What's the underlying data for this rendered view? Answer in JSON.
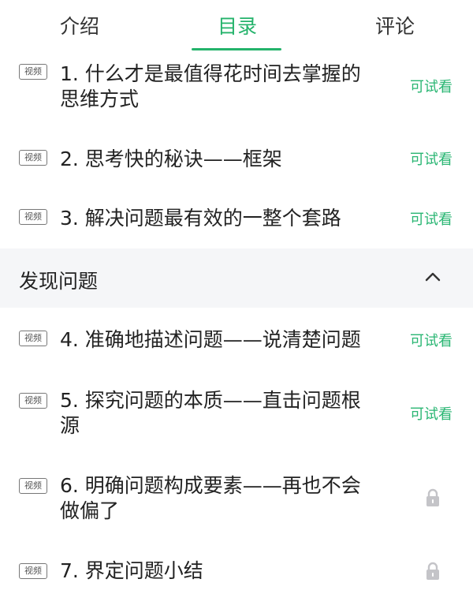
{
  "tabs": [
    {
      "label": "介绍",
      "active": false
    },
    {
      "label": "目录",
      "active": true
    },
    {
      "label": "评论",
      "active": false
    }
  ],
  "badge_label": "视频",
  "trial_label": "可试看",
  "section": {
    "title": "发现问题",
    "expanded": true
  },
  "lessons": [
    {
      "title": "1. 什么才是最值得花时间去掌握的思维方式",
      "status": "trial"
    },
    {
      "title": "2. 思考快的秘诀——框架",
      "status": "trial"
    },
    {
      "title": "3. 解决问题最有效的一整个套路",
      "status": "trial"
    },
    {
      "title": "4. 准确地描述问题——说清楚问题",
      "status": "trial"
    },
    {
      "title": "5. 探究问题的本质——直击问题根源",
      "status": "trial"
    },
    {
      "title": "6. 明确问题构成要素——再也不会做偏了",
      "status": "locked"
    },
    {
      "title": "7. 界定问题小结",
      "status": "locked"
    }
  ],
  "colors": {
    "accent": "#24b36b",
    "section_bg": "#f5f6f8",
    "lock": "#c4c4c8"
  }
}
